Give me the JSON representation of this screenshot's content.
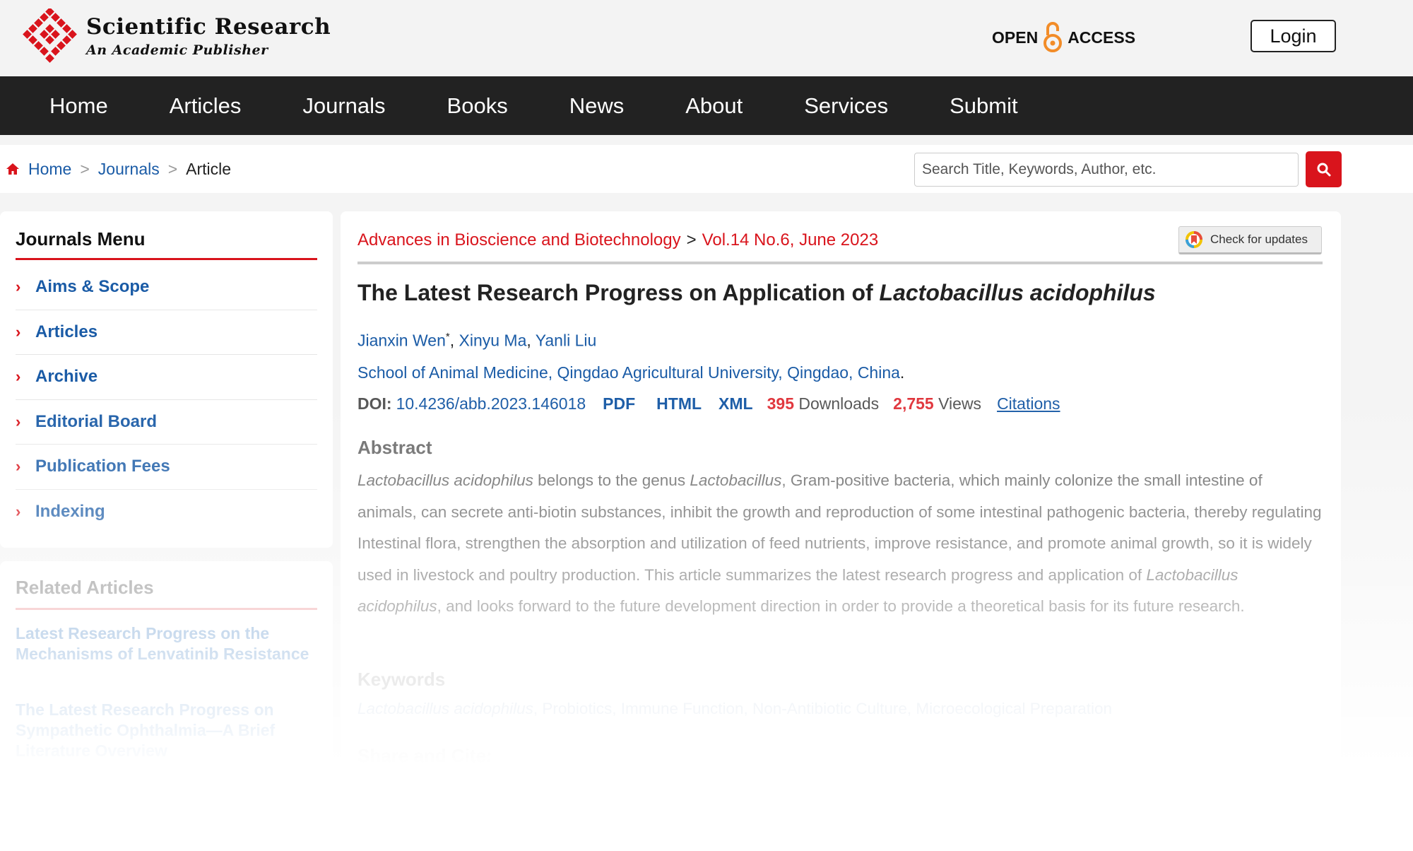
{
  "header": {
    "brand_name": "Scientific Research",
    "brand_tagline": "An Academic Publisher",
    "open_access_left": "OPEN",
    "open_access_right": "ACCESS",
    "login_label": "Login"
  },
  "nav": {
    "items": [
      "Home",
      "Articles",
      "Journals",
      "Books",
      "News",
      "About",
      "Services",
      "Submit"
    ]
  },
  "breadcrumb": {
    "home": "Home",
    "journals": "Journals",
    "current": "Article",
    "separator": ">"
  },
  "search": {
    "placeholder": "Search Title, Keywords, Author, etc."
  },
  "sidebar": {
    "menu_title": "Journals Menu",
    "menu_items": [
      "Aims & Scope",
      "Articles",
      "Archive",
      "Editorial Board",
      "Publication Fees",
      "Indexing"
    ],
    "related_title": "Related Articles",
    "related_items": [
      "Latest Research Progress on the Mechanisms of Lenvatinib Resistance",
      "The Latest Research Progress on Sympathetic Ophthalmia—A Brief Literature Overview"
    ]
  },
  "article": {
    "journal": "Advances in Bioscience and Biotechnology",
    "issue": "Vol.14 No.6, June 2023",
    "check_updates": "Check for updates",
    "title_plain": "The Latest Research Progress on Application of ",
    "title_italic": "Lactobacillus acidophilus",
    "authors": [
      "Jianxin Wen",
      "Xinyu Ma",
      "Yanli Liu"
    ],
    "corresponding_mark": "*",
    "affiliation": "School of Animal Medicine, Qingdao Agricultural University, Qingdao, China",
    "doi_label": "DOI:",
    "doi": "10.4236/abb.2023.146018",
    "formats": [
      "PDF",
      "HTML",
      "XML"
    ],
    "downloads_count": "395",
    "downloads_label": "Downloads",
    "views_count": "2,755",
    "views_label": "Views",
    "citations_label": "Citations",
    "abstract_heading": "Abstract",
    "abstract": {
      "part1_italic": "Lactobacillus acidophilus",
      "part2": " belongs to the genus ",
      "part3_italic": "Lactobacillus",
      "part4": ", Gram-positive bacteria, which mainly colonize the small intestine of animals, can secrete anti-biotin substances, inhibit the growth and reproduction of some intestinal pathogenic bacteria, thereby regulating Intestinal flora, strengthen the absorption and utilization of feed nutrients, improve resistance, and promote animal growth, so it is widely used in livestock and poultry production. This article summarizes the latest research progress and application of ",
      "part5_italic": "Lactobacillus acidophilus",
      "part6": ", and looks forward to the future development direction in order to provide a theoretical basis for its future research."
    },
    "keywords_heading": "Keywords",
    "keyword_first_italic": "Lactobacillus acidophilus",
    "keywords_rest": ", Probiotics, Immune Function, Non-Antibiotic Culture, Microecological Preparation",
    "share_heading": "Share and Cite:"
  },
  "colors": {
    "brand_red": "#d9141c",
    "link_blue": "#1a5ba6",
    "nav_bg": "#222222",
    "count_red": "#e0343b",
    "open_access_orange": "#f28c28"
  },
  "icons": {
    "logo": "red-diamond-grid-logo",
    "open_access": "open-lock-icon",
    "home": "home-icon",
    "search": "search-icon",
    "menu_bullet": "chevron-right-icon",
    "check_updates": "crossmark-icon"
  }
}
